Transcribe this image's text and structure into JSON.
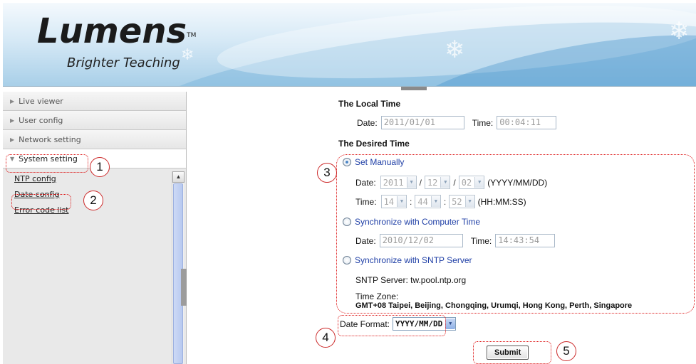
{
  "header": {
    "logo_text": "Lumens",
    "trademark": "TM",
    "tagline": "Brighter Teaching"
  },
  "sidebar": {
    "items": [
      {
        "label": "Live viewer",
        "icon": "triangle-right-icon"
      },
      {
        "label": "User config",
        "icon": "triangle-right-icon"
      },
      {
        "label": "Network setting",
        "icon": "triangle-right-icon"
      },
      {
        "label": "System setting",
        "icon": "triangle-down-icon"
      }
    ],
    "sublinks": [
      "NTP config",
      "Date config",
      "Error code list"
    ]
  },
  "main": {
    "local_time": {
      "heading": "The Local Time",
      "date_label": "Date:",
      "date_value": "2011/01/01",
      "time_label": "Time:",
      "time_value": "00:04:11"
    },
    "desired_time": {
      "heading": "The Desired Time",
      "manual": {
        "label": "Set Manually",
        "selected": true,
        "date_label": "Date:",
        "year": "2011",
        "month": "12",
        "day": "02",
        "date_sep": "/",
        "date_hint": "(YYYY/MM/DD)",
        "time_label": "Time:",
        "hour": "14",
        "minute": "44",
        "second": "52",
        "time_sep": ":",
        "time_hint": "(HH:MM:SS)"
      },
      "sync_computer": {
        "label": "Synchronize with Computer Time",
        "selected": false,
        "date_label": "Date:",
        "date_value": "2010/12/02",
        "time_label": "Time:",
        "time_value": "14:43:54"
      },
      "sync_sntp": {
        "label": "Synchronize with SNTP Server",
        "selected": false,
        "server_text": "SNTP Server: tw.pool.ntp.org",
        "timezone_label": "Time Zone:",
        "timezone_value": "GMT+08 Taipei, Beijing, Chongqing, Urumqi, Hong Kong, Perth, Singapore"
      }
    },
    "date_format": {
      "label": "Date Format:",
      "value": "YYYY/MM/DD"
    },
    "submit_label": "Submit"
  },
  "callouts": [
    "1",
    "2",
    "3",
    "4",
    "5"
  ],
  "colors": {
    "callout_border": "#cc2a2a",
    "radio_label": "#1f3fa6",
    "banner_blue": "#a8cfe8"
  }
}
